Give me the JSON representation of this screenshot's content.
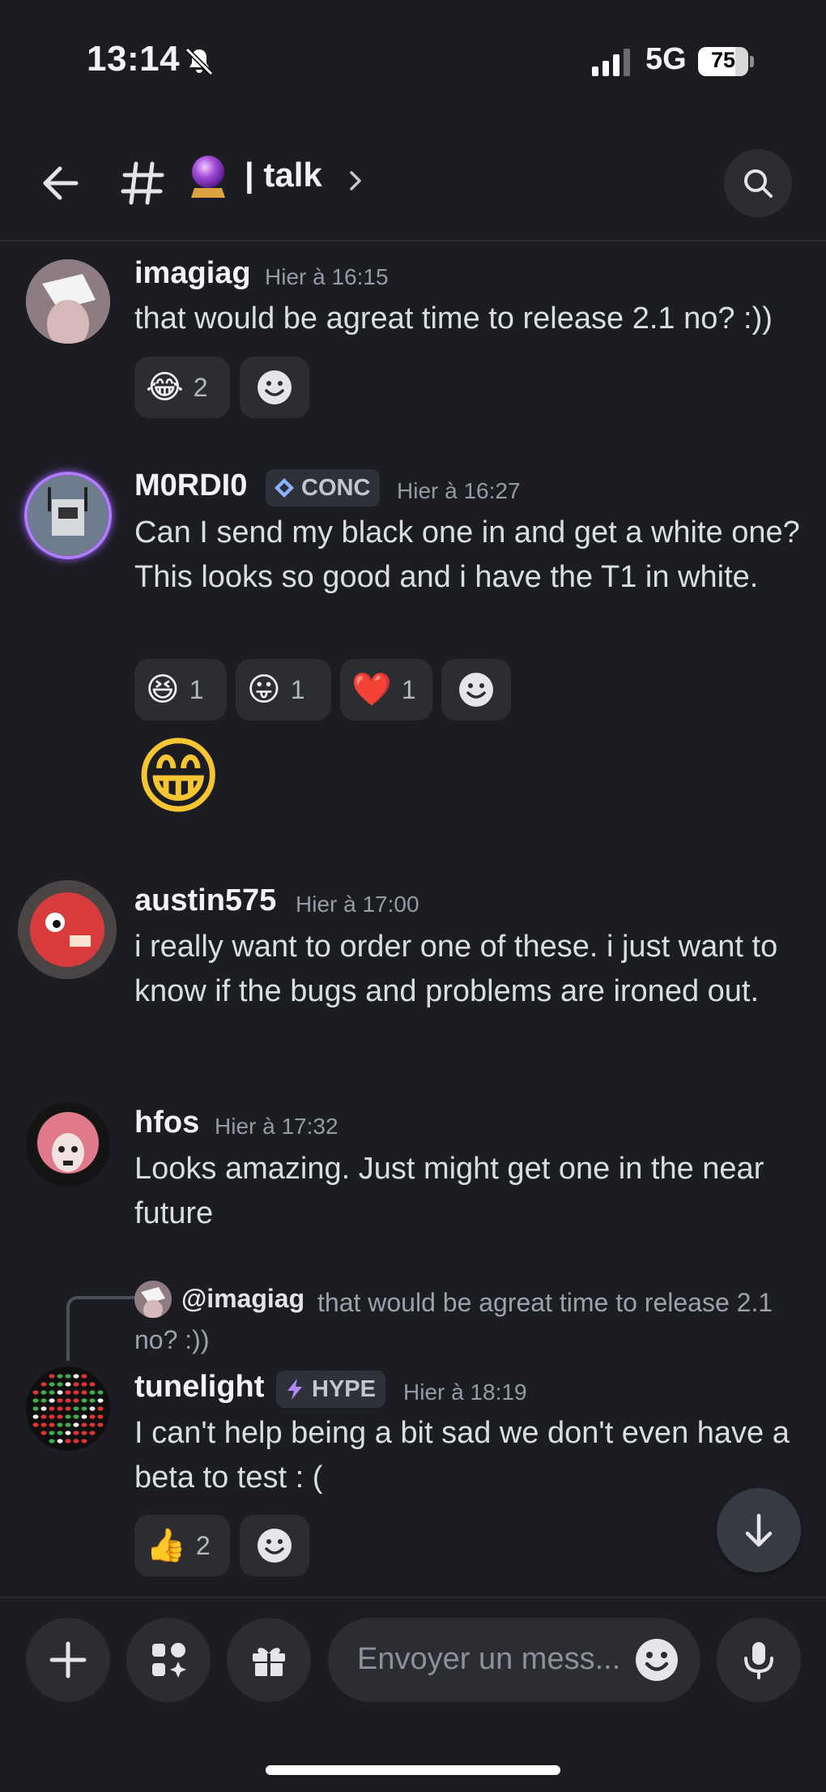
{
  "status_bar": {
    "time": "13:14",
    "network": "5G",
    "battery": "75"
  },
  "header": {
    "channel_name": "| talk"
  },
  "messages": [
    {
      "username": "imagiag",
      "timestamp": "Hier à 16:15",
      "text": "that would be agreat time to release 2.1 no? :))",
      "reactions": [
        {
          "emoji": "😂",
          "count": "2"
        }
      ]
    },
    {
      "username": "M0RDI0",
      "badge": "CONC",
      "timestamp": "Hier à 16:27",
      "text": "Can I send my black one in and get a white one?  This looks so good and i have the T1 in white.",
      "reactions": [
        {
          "emoji": "😆",
          "count": "1"
        },
        {
          "emoji": "😛",
          "count": "1"
        },
        {
          "emoji": "❤️",
          "count": "1"
        }
      ],
      "big_emoji": "😁"
    },
    {
      "username": "austin575",
      "timestamp": "Hier à 17:00",
      "text": "i really want to order one of these. i just want to know if the bugs and problems are ironed out."
    },
    {
      "username": "hfos",
      "timestamp": "Hier à 17:32",
      "text": "Looks amazing. Just might get one in the near future"
    },
    {
      "reply_to_user": "@imagiag",
      "reply_to_text": "that would be agreat time to release 2.1 no? :))",
      "username": "tunelight",
      "badge": "HYPE",
      "timestamp": "Hier à 18:19",
      "text": "I can't help being a bit sad we don't even have a beta to test : (",
      "reactions": [
        {
          "emoji": "👍",
          "count": "2"
        }
      ]
    }
  ],
  "composer": {
    "placeholder": "Envoyer un mess..."
  },
  "colors": {
    "background": "#1c1d23",
    "surface": "#2b2d33",
    "text": "#dbdee1",
    "muted": "#989aa2"
  }
}
